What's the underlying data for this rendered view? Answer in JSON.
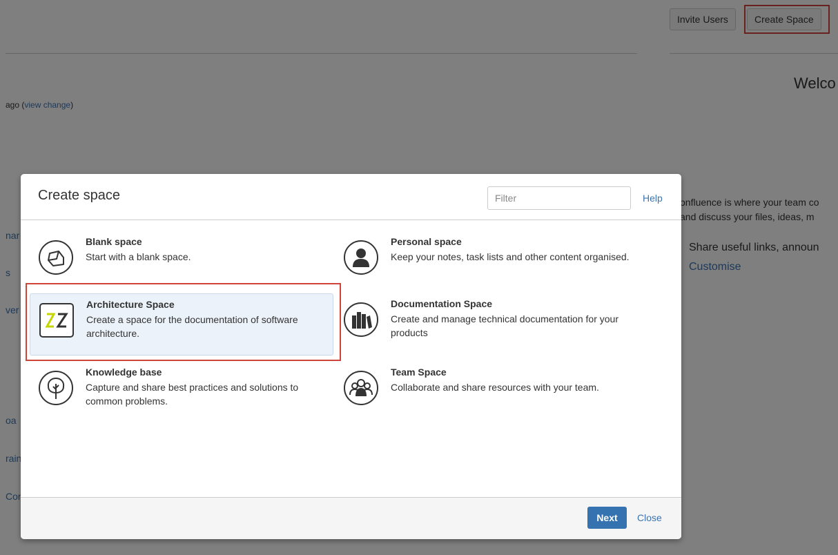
{
  "header": {
    "invite_users": "Invite Users",
    "create_space": "Create Space"
  },
  "background": {
    "ago_text": "ago (",
    "view_change": "view change",
    "ago_close": ")",
    "welcome": "Welco",
    "frags": [
      "nar",
      "s",
      "ver",
      "oa",
      "rain",
      "Con"
    ],
    "intro_line1": "onfluence is where your team co",
    "intro_line2": "and discuss your files, ideas, m",
    "share_text": "Share useful links, announ",
    "customise": "Customise"
  },
  "dialog": {
    "title": "Create space",
    "filter_placeholder": "Filter",
    "help": "Help",
    "templates": [
      {
        "name": "Blank space",
        "desc": "Start with a blank space.",
        "icon": "blank-space-icon"
      },
      {
        "name": "Personal space",
        "desc": "Keep your notes, task lists and other content organised.",
        "icon": "personal-space-icon"
      },
      {
        "name": "Architecture Space",
        "desc": "Create a space for the documentation of software architecture.",
        "icon": "architecture-space-icon",
        "selected": true
      },
      {
        "name": "Documentation Space",
        "desc": "Create and manage technical documentation for your products",
        "icon": "documentation-space-icon"
      },
      {
        "name": "Knowledge base",
        "desc": "Capture and share best practices and solutions to common problems.",
        "icon": "knowledge-base-icon"
      },
      {
        "name": "Team Space",
        "desc": "Collaborate and share resources with your team.",
        "icon": "team-space-icon"
      }
    ],
    "next": "Next",
    "close": "Close"
  },
  "colors": {
    "highlight": "#d04437",
    "link": "#3b73af",
    "primary_button": "#3572b0",
    "selected_bg": "#ebf2f9"
  }
}
